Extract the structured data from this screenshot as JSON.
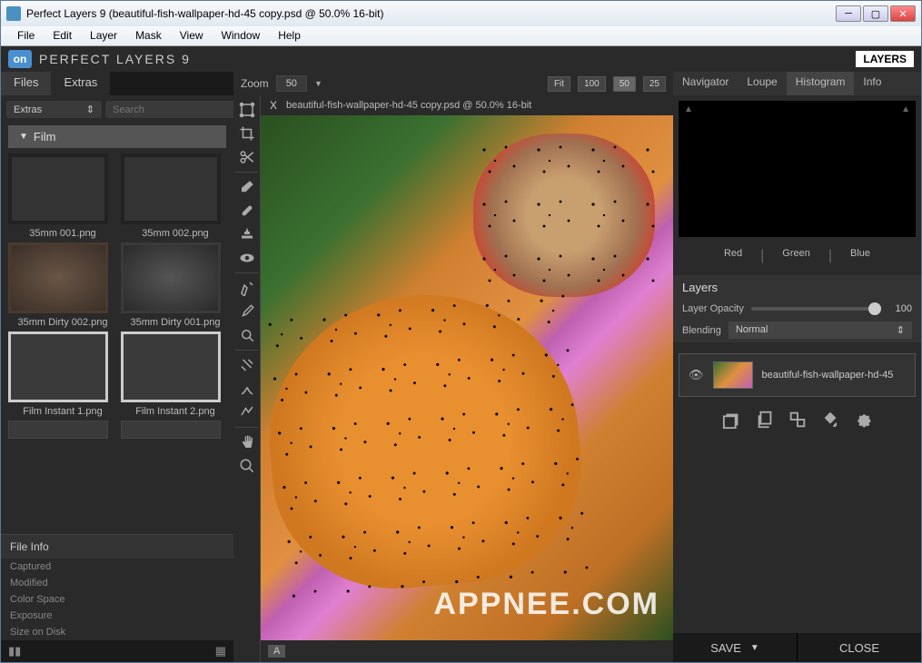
{
  "titlebar": {
    "text": "Perfect Layers 9 (beautiful-fish-wallpaper-hd-45 copy.psd @ 50.0% 16-bit)"
  },
  "menu": {
    "file": "File",
    "edit": "Edit",
    "layer": "Layer",
    "mask": "Mask",
    "view": "View",
    "window": "Window",
    "help": "Help"
  },
  "header": {
    "logo": "on",
    "title": "PERFECT LAYERS 9",
    "layers_btn": "LAYERS"
  },
  "left": {
    "tab_files": "Files",
    "tab_extras": "Extras",
    "filter_selected": "Extras",
    "search_placeholder": "Search",
    "category": "Film",
    "thumbs": [
      {
        "label": "35mm 001.png"
      },
      {
        "label": "35mm 002.png"
      },
      {
        "label": "35mm Dirty 002.png"
      },
      {
        "label": "35mm Dirty  001.png"
      },
      {
        "label": "Film Instant 1.png"
      },
      {
        "label": "Film Instant 2.png"
      }
    ],
    "file_info_header": "File Info",
    "file_info_rows": {
      "captured": "Captured",
      "modified": "Modified",
      "colorspace": "Color Space",
      "exposure": "Exposure",
      "size": "Size on Disk"
    }
  },
  "center": {
    "zoom_label": "Zoom",
    "zoom_value": "50",
    "fit": "Fit",
    "z100": "100",
    "z50": "50",
    "z25": "25",
    "doc_title": "beautiful-fish-wallpaper-hd-45 copy.psd @ 50.0% 16-bit",
    "footer_a": "A",
    "watermark": "APPNEE.COM"
  },
  "right": {
    "tab_nav": "Navigator",
    "tab_loupe": "Loupe",
    "tab_hist": "Histogram",
    "tab_info": "Info",
    "rgb": {
      "r": "Red",
      "g": "Green",
      "b": "Blue"
    },
    "layers_header": "Layers",
    "opacity_label": "Layer Opacity",
    "opacity_value": "100",
    "blend_label": "Blending",
    "blend_value": "Normal",
    "layer_name": "beautiful-fish-wallpaper-hd-45",
    "save": "SAVE",
    "close": "CLOSE"
  }
}
